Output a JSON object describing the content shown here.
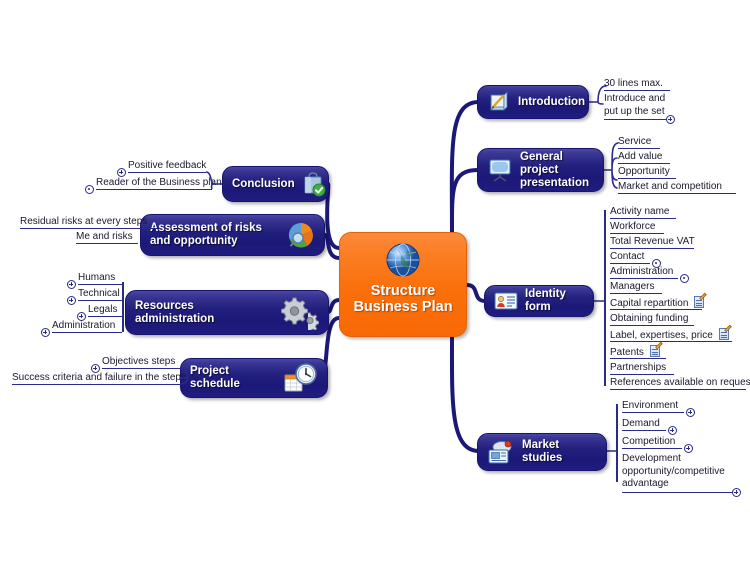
{
  "map": {
    "title": "Structure Business Plan",
    "central": {
      "label_line1": "Structure",
      "label_line2": "Business Plan",
      "icon": "globe-icon",
      "color": "#f97010"
    },
    "node_color": "#201d80",
    "link_color": "#1b1878"
  },
  "branches": [
    {
      "id": "introduction",
      "label": "Introduction",
      "icon": "notepad-pencil-icon",
      "side": "right",
      "children": [
        {
          "label": "30 lines max.",
          "marker": "none"
        },
        {
          "label": "Introduce and put up the set",
          "marker": "plus"
        }
      ]
    },
    {
      "id": "general-project-presentation",
      "label": "General project presentation",
      "icon": "presentation-screen-icon",
      "side": "right",
      "children": [
        {
          "label": "Service",
          "marker": "none"
        },
        {
          "label": "Add value",
          "marker": "none"
        },
        {
          "label": "Opportunity",
          "marker": "none"
        },
        {
          "label": "Market and competition",
          "marker": "none"
        }
      ]
    },
    {
      "id": "identity-form",
      "label": "Identity form",
      "icon": "id-card-icon",
      "side": "right",
      "children": [
        {
          "label": "Activity name",
          "marker": "none"
        },
        {
          "label": "Workforce",
          "marker": "none"
        },
        {
          "label": "Total Revenue VAT",
          "marker": "none"
        },
        {
          "label": "Contact",
          "marker": "dot"
        },
        {
          "label": "Administration",
          "marker": "dot"
        },
        {
          "label": "Managers",
          "marker": "none"
        },
        {
          "label": "Capital repartition",
          "marker": "none",
          "note": true
        },
        {
          "label": "Obtaining funding",
          "marker": "none"
        },
        {
          "label": "Label, expertises, price",
          "marker": "none",
          "note": true
        },
        {
          "label": "Patents",
          "marker": "none",
          "note": true
        },
        {
          "label": "Partnerships",
          "marker": "none"
        },
        {
          "label": "References available on request",
          "marker": "none"
        }
      ]
    },
    {
      "id": "market-studies",
      "label": "Market studies",
      "icon": "market-monitor-icon",
      "side": "right",
      "children": [
        {
          "label": "Environment",
          "marker": "plus"
        },
        {
          "label": "Demand",
          "marker": "plus"
        },
        {
          "label": "Competition",
          "marker": "plus"
        },
        {
          "label": "Development opportunity/competitive advantage",
          "marker": "plus"
        }
      ]
    },
    {
      "id": "conclusion",
      "label": "Conclusion",
      "icon": "bag-check-icon",
      "side": "left",
      "children": [
        {
          "label": "Positive feedback",
          "marker": "plus"
        },
        {
          "label": "Reader of the Business plan",
          "marker": "dot"
        }
      ]
    },
    {
      "id": "assessment-of-risks-and-opportunity",
      "label": "Assessment of risks and opportunity",
      "icon": "pie-chart-icon",
      "side": "left",
      "children": [
        {
          "label": "Residual risks at every steps",
          "marker": "none"
        },
        {
          "label": "Me and risks",
          "marker": "none"
        }
      ]
    },
    {
      "id": "resources-administration",
      "label": "Resources administration",
      "icon": "gears-icon",
      "side": "left",
      "children": [
        {
          "label": "Humans",
          "marker": "plus"
        },
        {
          "label": "Technical",
          "marker": "plus"
        },
        {
          "label": "Legals",
          "marker": "plus"
        },
        {
          "label": "Administration",
          "marker": "plus"
        }
      ]
    },
    {
      "id": "project-schedule",
      "label": "Project schedule",
      "icon": "clock-calendar-icon",
      "side": "left",
      "children": [
        {
          "label": "Objectives steps",
          "marker": "plus"
        },
        {
          "label": "Success criteria and failure in the steps",
          "marker": "none"
        }
      ]
    }
  ]
}
